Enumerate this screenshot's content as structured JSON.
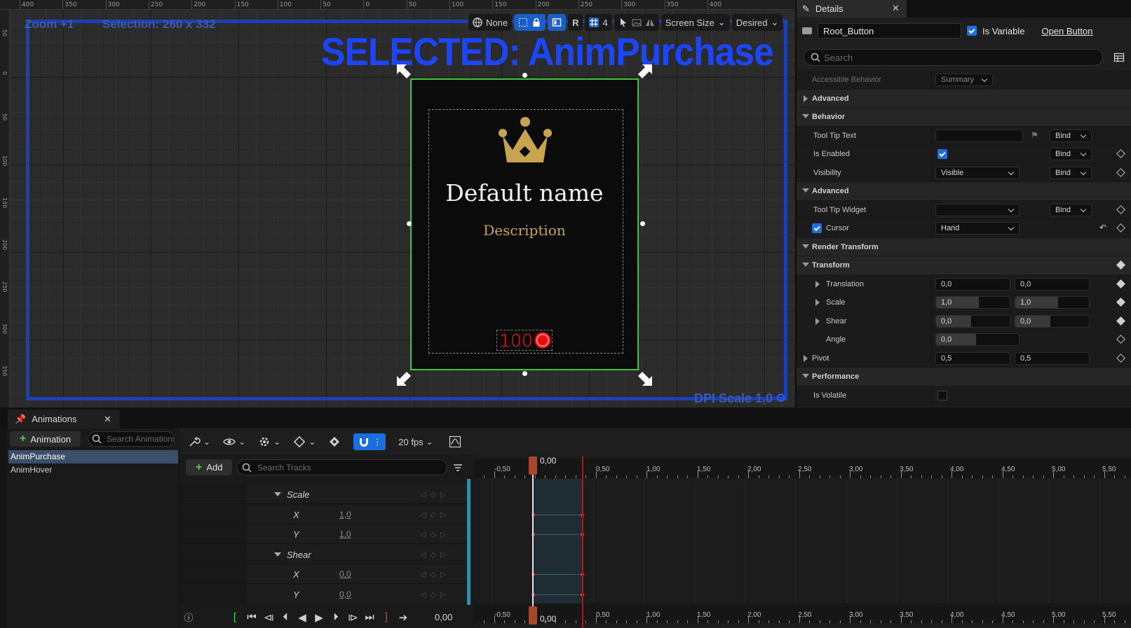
{
  "viewport": {
    "zoom_label": "Zoom +1",
    "selection_label": "Selection: 260 x 332",
    "selected_banner": "SELECTED: AnimPurchase",
    "dpi_label": "DPI Scale 1,0",
    "ruler_top": [
      "400",
      "350",
      "300",
      "250",
      "200",
      "150",
      "100",
      "50",
      "0",
      "50",
      "100",
      "150",
      "200",
      "250",
      "300",
      "350",
      "400"
    ],
    "ruler_left": [
      "50",
      "0",
      "50",
      "100",
      "150",
      "200",
      "250",
      "300",
      "350"
    ],
    "toolbar": {
      "none_label": "None",
      "r_label": "R",
      "grid_count": "4",
      "screen_size": "Screen Size",
      "desired": "Desired"
    }
  },
  "widget_card": {
    "name": "Default name",
    "description": "Description",
    "price": "100"
  },
  "details": {
    "tab_title": "Details",
    "widget_name": "Root_Button",
    "is_variable_label": "Is Variable",
    "is_variable_checked": true,
    "open_button": "Open Button",
    "search_placeholder": "Search",
    "rows": [
      {
        "label": "Accessible Behavior",
        "kind": "faded",
        "dropdown": "Summary"
      },
      {
        "label": "Advanced",
        "kind": "cat-collapsed"
      },
      {
        "label": "Behavior",
        "kind": "cat"
      },
      {
        "label": "Tool Tip Text",
        "kind": "text-bind",
        "bind": "Bind"
      },
      {
        "label": "Is Enabled",
        "kind": "check-bind",
        "bind": "Bind"
      },
      {
        "label": "Visibility",
        "kind": "dropdown-bind",
        "dropdown": "Visible",
        "bind": "Bind"
      },
      {
        "label": "Advanced",
        "kind": "subcat"
      },
      {
        "label": "Tool Tip Widget",
        "kind": "dropdown-bind",
        "dropdown": "",
        "bind": "Bind"
      },
      {
        "label": "Cursor",
        "kind": "cursor",
        "dropdown": "Hand"
      },
      {
        "label": "Render Transform",
        "kind": "cat"
      },
      {
        "label": "Transform",
        "kind": "subcat"
      },
      {
        "label": "Translation",
        "kind": "vec",
        "x": "0,0",
        "y": "0,0"
      },
      {
        "label": "Scale",
        "kind": "vec",
        "x": "1,0",
        "y": "1,0"
      },
      {
        "label": "Shear",
        "kind": "vec",
        "x": "0,0",
        "y": "0,0"
      },
      {
        "label": "Angle",
        "kind": "scalar",
        "x": "0,0"
      },
      {
        "label": "Pivot",
        "kind": "pivot",
        "x": "0,5",
        "y": "0,5"
      },
      {
        "label": "Performance",
        "kind": "cat"
      },
      {
        "label": "Is Volatile",
        "kind": "check"
      }
    ]
  },
  "animations": {
    "tab_title": "Animations",
    "add_label": "Animation",
    "search_placeholder": "Search Animations",
    "items": [
      "AnimPurchase",
      "AnimHover"
    ],
    "selected": "AnimPurchase"
  },
  "sequencer": {
    "fps": "20 fps",
    "add_label": "Add",
    "search_tracks_placeholder": "Search Tracks",
    "tracks": [
      {
        "name": "Scale",
        "type": "group"
      },
      {
        "name": "X",
        "value": "1,0",
        "type": "channel"
      },
      {
        "name": "Y",
        "value": "1,0",
        "type": "channel"
      },
      {
        "name": "Shear",
        "type": "group"
      },
      {
        "name": "X",
        "value": "0,0",
        "type": "channel"
      },
      {
        "name": "Y",
        "value": "0,0",
        "type": "channel"
      }
    ],
    "playhead_time": "0,00",
    "current_time": "0,00",
    "timeline_labels": [
      "-0,50",
      "0,50",
      "1,00",
      "1,50",
      "2,00",
      "2,50",
      "3,00",
      "3,50",
      "4,00",
      "4,50",
      "5,00",
      "5,50"
    ]
  }
}
